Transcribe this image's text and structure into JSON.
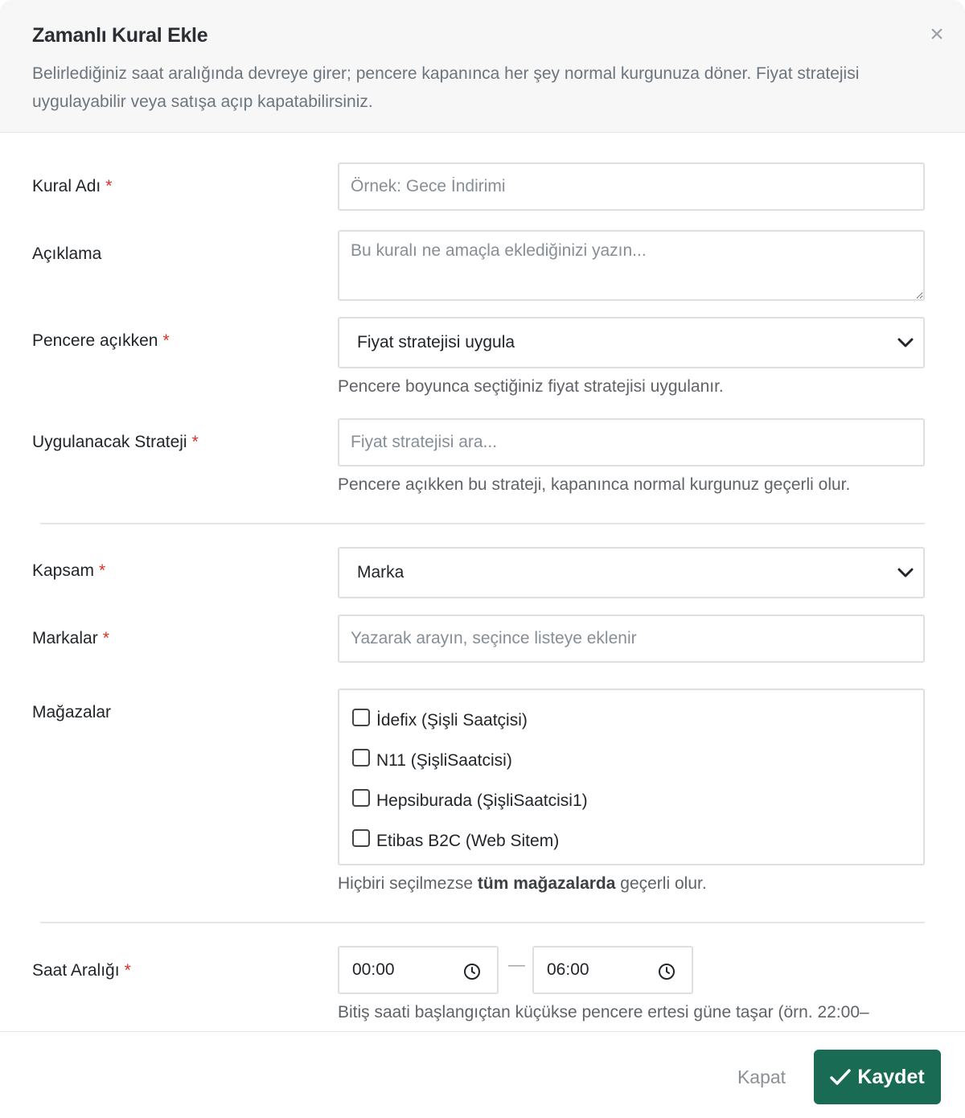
{
  "modal": {
    "title": "Zamanlı Kural Ekle",
    "subtitle": "Belirlediğiniz saat aralığında devreye girer; pencere kapanınca her şey normal kurgunuza döner. Fiyat stratejisi uygulayabilir veya satışa açıp kapatabilirsiniz.",
    "close_icon": "×"
  },
  "form": {
    "rule_name": {
      "label": "Kural Adı",
      "placeholder": "Örnek: Gece İndirimi",
      "value": ""
    },
    "description": {
      "label": "Açıklama",
      "placeholder": "Bu kuralı ne amaçla eklediğinizi yazın...",
      "value": ""
    },
    "window_open": {
      "label": "Pencere açıkken",
      "selected": "Fiyat stratejisi uygula",
      "help": "Pencere boyunca seçtiğiniz fiyat stratejisi uygulanır."
    },
    "strategy": {
      "label": "Uygulanacak Strateji",
      "placeholder": "Fiyat stratejisi ara...",
      "help": "Pencere açıkken bu strateji, kapanınca normal kurgunuz geçerli olur."
    },
    "scope": {
      "label": "Kapsam",
      "selected": "Marka"
    },
    "brands": {
      "label": "Markalar",
      "placeholder": "Yazarak arayın, seçince listeye eklenir"
    },
    "stores": {
      "label": "Mağazalar",
      "items": [
        {
          "label": "İdefix (Şişli Saatçisi)",
          "checked": false
        },
        {
          "label": "N11 (ŞişliSaatcisi)",
          "checked": false
        },
        {
          "label": "Hepsiburada (ŞişliSaatcisi1)",
          "checked": false
        },
        {
          "label": "Etibas B2C (Web Sitem)",
          "checked": false
        }
      ],
      "help_prefix": "Hiçbiri seçilmezse ",
      "help_bold": "tüm mağazalarda",
      "help_suffix": " geçerli olur."
    },
    "time_range": {
      "label": "Saat Aralığı",
      "start": "00:00",
      "separator": "—",
      "end": "06:00",
      "help": "Bitiş saati başlangıçtan küçükse pencere ertesi güne taşar (örn. 22:00–"
    },
    "required_mark": "*"
  },
  "footer": {
    "close_label": "Kapat",
    "save_label": "Kaydet"
  },
  "colors": {
    "primary": "#1a6b53",
    "required": "#d93025"
  }
}
